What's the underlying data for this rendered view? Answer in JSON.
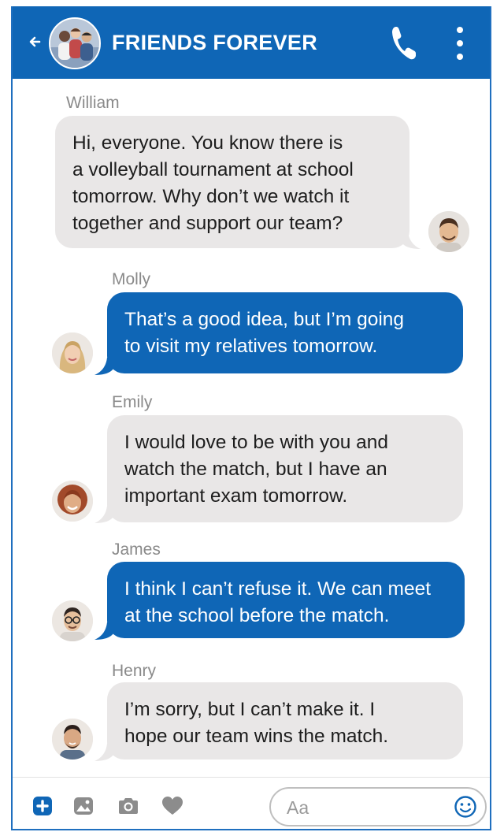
{
  "header": {
    "title": "FRIENDS FOREVER",
    "back_icon": "back-arrow-icon",
    "phone_icon": "phone-icon",
    "menu_icon": "more-vertical-icon",
    "color": "#0f66b6"
  },
  "messages": [
    {
      "sender": "William",
      "lines": [
        "Hi, everyone. You know there is",
        "a volleyball tournament at school",
        "tomorrow. Why don’t we watch it",
        "together and support our team?"
      ],
      "style": "grey"
    },
    {
      "sender": "Molly",
      "lines": [
        "That’s a good idea, but I’m going",
        "to visit my relatives tomorrow."
      ],
      "style": "blue"
    },
    {
      "sender": "Emily",
      "lines": [
        "I would love to be with you and",
        "watch the match, but I have an",
        "important exam tomorrow."
      ],
      "style": "grey"
    },
    {
      "sender": "James",
      "lines": [
        "I think I can’t refuse it. We can meet",
        "at the school before the match."
      ],
      "style": "blue"
    },
    {
      "sender": "Henry",
      "lines": [
        "I’m sorry, but I can’t make it. I",
        "hope our team wins the match."
      ],
      "style": "grey"
    }
  ],
  "footer": {
    "icons": [
      "plus-icon",
      "image-icon",
      "camera-icon",
      "heart-icon"
    ],
    "input_placeholder": "Aa",
    "emoji_icon": "emoji-icon"
  },
  "colors": {
    "accent": "#0f66b6",
    "grey_bubble": "#e9e7e7",
    "footer_icon": "#8c8c8c"
  }
}
